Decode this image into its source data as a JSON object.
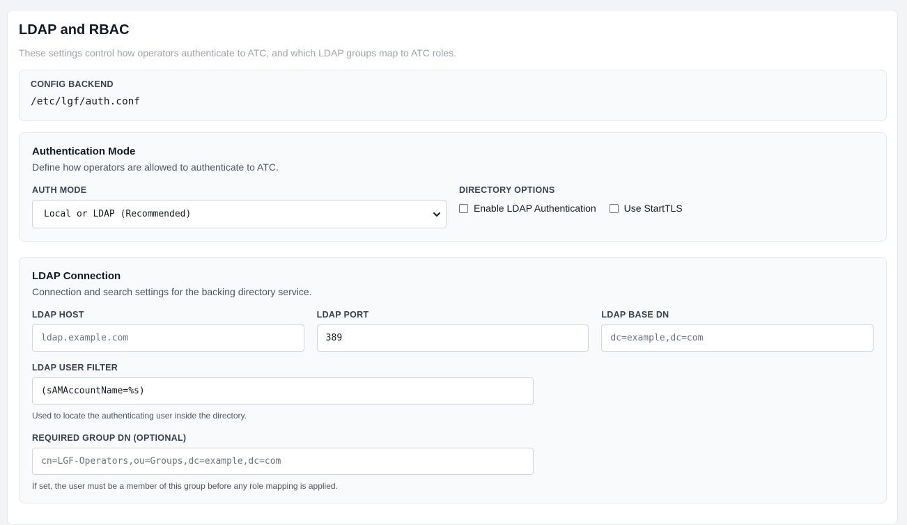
{
  "page": {
    "title": "LDAP and RBAC",
    "subtitle": "These settings control how operators authenticate to ATC, and which LDAP groups map to ATC roles."
  },
  "backend": {
    "label": "CONFIG BACKEND",
    "value": "/etc/lgf/auth.conf"
  },
  "auth": {
    "title": "Authentication Mode",
    "description": "Define how operators are allowed to authenticate to ATC.",
    "mode_label": "AUTH MODE",
    "mode_value": "Local or LDAP (Recommended)",
    "options_label": "DIRECTORY OPTIONS",
    "enable_ldap_label": "Enable LDAP Authentication",
    "starttls_label": "Use StartTLS"
  },
  "ldap": {
    "title": "LDAP Connection",
    "description": "Connection and search settings for the backing directory service.",
    "host_label": "LDAP HOST",
    "host_placeholder": "ldap.example.com",
    "port_label": "LDAP PORT",
    "port_value": "389",
    "base_dn_label": "LDAP BASE DN",
    "base_dn_placeholder": "dc=example,dc=com",
    "user_filter_label": "LDAP USER FILTER",
    "user_filter_value": "(sAMAccountName=%s)",
    "user_filter_hint": "Used to locate the authenticating user inside the directory.",
    "group_dn_label": "REQUIRED GROUP DN (OPTIONAL)",
    "group_dn_placeholder": "cn=LGF-Operators,ou=Groups,dc=example,dc=com",
    "group_dn_hint": "If set, the user must be a member of this group before any role mapping is applied."
  }
}
